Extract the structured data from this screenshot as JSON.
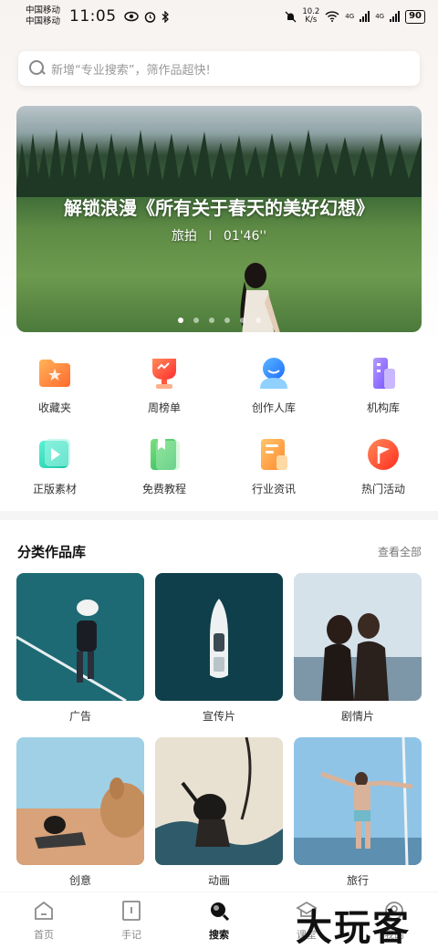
{
  "status_bar": {
    "carrier_1": "中国移动",
    "carrier_2": "中国移动",
    "time": "11:05",
    "speed_value": "10.2",
    "speed_unit": "K/s",
    "network_1": "4G",
    "network_2": "4G",
    "battery": "90"
  },
  "search": {
    "placeholder": "新增“专业搜索”，筛作品超快!"
  },
  "banner": {
    "title": "解锁浪漫《所有关于春天的美好幻想》",
    "category": "旅拍",
    "separator": "I",
    "duration": "01'46''",
    "dot_count": 6,
    "active_dot": 1
  },
  "quick_links": [
    {
      "label": "收藏夹",
      "icon": "folder-star-icon",
      "color": "#ff7a3d"
    },
    {
      "label": "周榜单",
      "icon": "trophy-icon",
      "color": "#ff4d3d"
    },
    {
      "label": "创作人库",
      "icon": "creator-avatar-icon",
      "color": "#2f8cff"
    },
    {
      "label": "机构库",
      "icon": "building-icon",
      "color": "#8a6bff"
    },
    {
      "label": "正版素材",
      "icon": "video-play-icon",
      "color": "#1fd1b0"
    },
    {
      "label": "免费教程",
      "icon": "book-bookmark-icon",
      "color": "#38c96a"
    },
    {
      "label": "行业资讯",
      "icon": "news-document-icon",
      "color": "#ff9d3d"
    },
    {
      "label": "热门活动",
      "icon": "flag-icon",
      "color": "#ff4a2d"
    }
  ],
  "category_section": {
    "title": "分类作品库",
    "view_all": "查看全部",
    "items": [
      {
        "label": "广告"
      },
      {
        "label": "宣传片"
      },
      {
        "label": "剧情片"
      },
      {
        "label": "创意"
      },
      {
        "label": "动画"
      },
      {
        "label": "旅行"
      }
    ]
  },
  "bottom_nav": [
    {
      "label": "首页",
      "icon": "home-icon",
      "active": false
    },
    {
      "label": "手记",
      "icon": "notebook-icon",
      "active": false
    },
    {
      "label": "搜索",
      "icon": "search-icon",
      "active": true
    },
    {
      "label": "课堂",
      "icon": "classroom-icon",
      "active": false
    },
    {
      "label": "我的",
      "icon": "profile-icon",
      "active": false
    }
  ],
  "watermark": "大玩客"
}
